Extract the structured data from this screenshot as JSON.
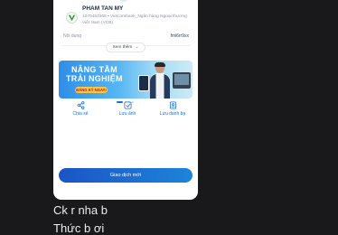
{
  "receipt": {
    "recipient_name": "PHAM TAN MY",
    "recipient_info": "1070453368 • Vietcombank_Ngân hàng Ngoại thương Việt Nam (VCB)",
    "content_label": "Nội dung",
    "content_value": "fmi6rr9xx",
    "more_button": "Xem thêm",
    "banner": {
      "line1": "NÂNG TẦM",
      "line2": "TRẢI NGHIỆM",
      "cta": "ĐĂNG KÝ NGAY!"
    },
    "actions": [
      {
        "label": "Chia sẻ",
        "icon": "share-icon"
      },
      {
        "label": "Lưu ảnh",
        "icon": "save-image-icon"
      },
      {
        "label": "Lưu danh bạ",
        "icon": "save-contact-icon"
      }
    ],
    "primary_button": "Giao dịch mới",
    "carousel": {
      "count": 4,
      "active": 0
    }
  },
  "chat": {
    "line1": "Ck r nha b",
    "line2": "Thức b ơi"
  },
  "colors": {
    "background": "#19191b",
    "accent": "#1f6fd2",
    "banner_cta": "#f6c945"
  }
}
